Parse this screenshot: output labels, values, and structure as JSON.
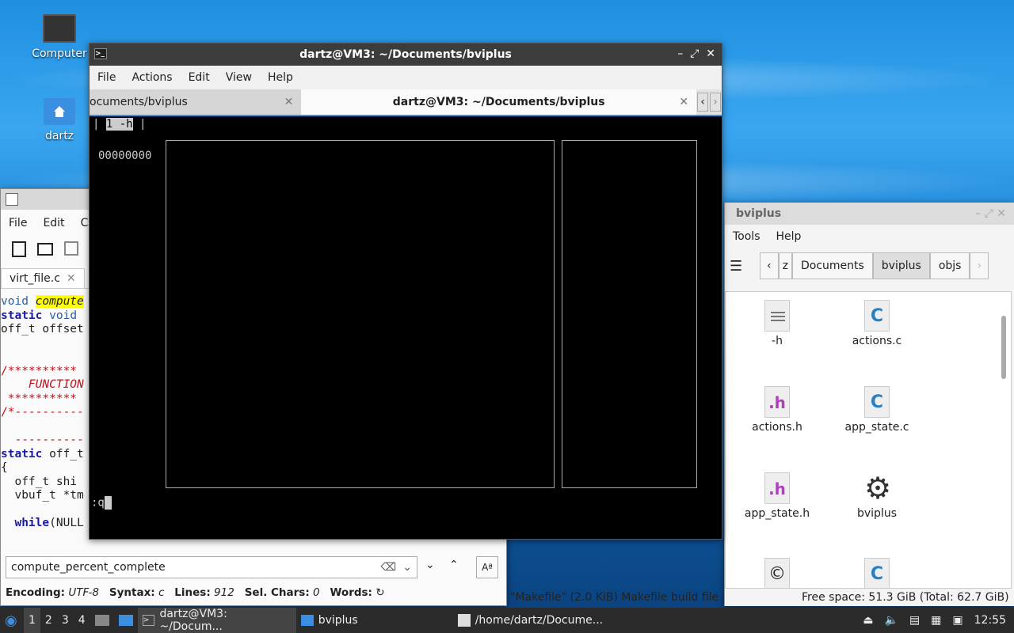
{
  "desktop": {
    "icons": [
      {
        "label": "Computer"
      },
      {
        "label": "dartz"
      }
    ]
  },
  "editor": {
    "menu": [
      "File",
      "Edit",
      "C"
    ],
    "tab_label": "virt_file.c",
    "search_value": "compute_percent_complete",
    "status": {
      "encoding_label": "Encoding:",
      "encoding": "UTF-8",
      "syntax_label": "Syntax:",
      "syntax": "c",
      "lines_label": "Lines:",
      "lines": "912",
      "selchars_label": "Sel. Chars:",
      "selchars": "0",
      "words_label": "Words:"
    }
  },
  "terminal": {
    "title": "dartz@VM3: ~/Documents/bviplus",
    "menu": [
      "File",
      "Actions",
      "Edit",
      "View",
      "Help"
    ],
    "tabs": [
      {
        "label": "ocuments/bviplus"
      },
      {
        "label": "dartz@VM3: ~/Documents/bviplus"
      }
    ],
    "status_line": "1 -h",
    "address": "00000000",
    "command": ":q"
  },
  "filemanager": {
    "title": "bviplus",
    "menu": [
      "Tools",
      "Help"
    ],
    "breadcrumbs": [
      "z",
      "Documents",
      "bviplus",
      "objs"
    ],
    "files": [
      {
        "name": "-h",
        "type": "text"
      },
      {
        "name": "actions.c",
        "type": "c"
      },
      {
        "name": "actions.h",
        "type": "h"
      },
      {
        "name": "app_state.c",
        "type": "c"
      },
      {
        "name": "app_state.h",
        "type": "h"
      },
      {
        "name": "bviplus",
        "type": "exec"
      }
    ],
    "status_left": "\"Makefile\" (2.0 KiB) Makefile build file",
    "status_right": "Free space: 51.3 GiB (Total: 62.7 GiB)"
  },
  "taskbar": {
    "workspaces": [
      "1",
      "2",
      "3",
      "4"
    ],
    "tasks": [
      {
        "label": "dartz@VM3: ~/Docum..."
      },
      {
        "label": "bviplus"
      },
      {
        "label": "/home/dartz/Docume..."
      }
    ],
    "clock": "12:55"
  }
}
